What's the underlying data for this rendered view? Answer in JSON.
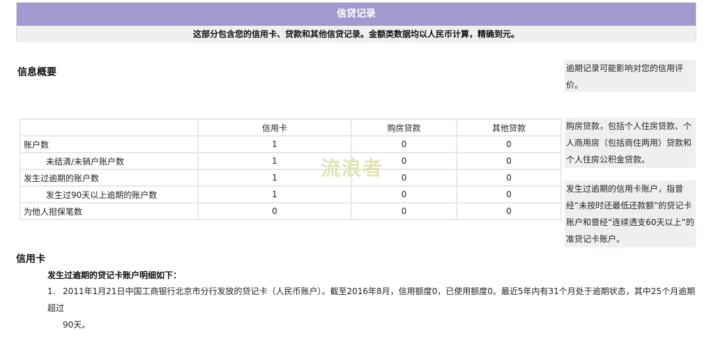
{
  "header": {
    "title": "信贷记录",
    "description": "这部分包含您的信用卡、贷款和其他信贷记录。金额类数据均以人民币计算，精确到元。"
  },
  "overview": {
    "title": "信息概要",
    "columns": [
      "",
      "信用卡",
      "购房贷款",
      "其他贷款"
    ],
    "rows": [
      {
        "label": "账户数",
        "values": [
          "1",
          "0",
          "0"
        ]
      },
      {
        "label": "未结清/未销户账户数",
        "values": [
          "1",
          "0",
          "0"
        ]
      },
      {
        "label": "发生过逾期的账户数",
        "values": [
          "1",
          "0",
          "0"
        ]
      },
      {
        "label": "发生过90天以上逾期的账户数",
        "values": [
          "1",
          "0",
          "0"
        ]
      },
      {
        "label": "为他人担保笔数",
        "values": [
          "0",
          "0",
          "0"
        ]
      }
    ]
  },
  "notes": [
    "逾期记录可能影响对您的信用评价。",
    "购房贷款，包括个人住房贷款、个人商用房（包括商住两用）贷款和个人住房公积金贷款。",
    "发生过逾期的信用卡账户，指曾经“未按时还最低还款额”的贷记卡账户和曾经“连续透支60天以上”的准贷记卡账户。"
  ],
  "watermark": "流浪者",
  "credit_card": {
    "title": "信用卡",
    "subtitle": "发生过逾期的贷记卡账户明细如下：",
    "items": [
      {
        "index": "1.",
        "line1": "2011年1月21日中国工商银行北京市分行发放的贷记卡（人民币账户）。截至2016年8月，信用额度0，已使用额度0。最近5年内有31个月处于逾期状态，其中25个月逾期超过",
        "line2": "90天。"
      }
    ]
  }
}
